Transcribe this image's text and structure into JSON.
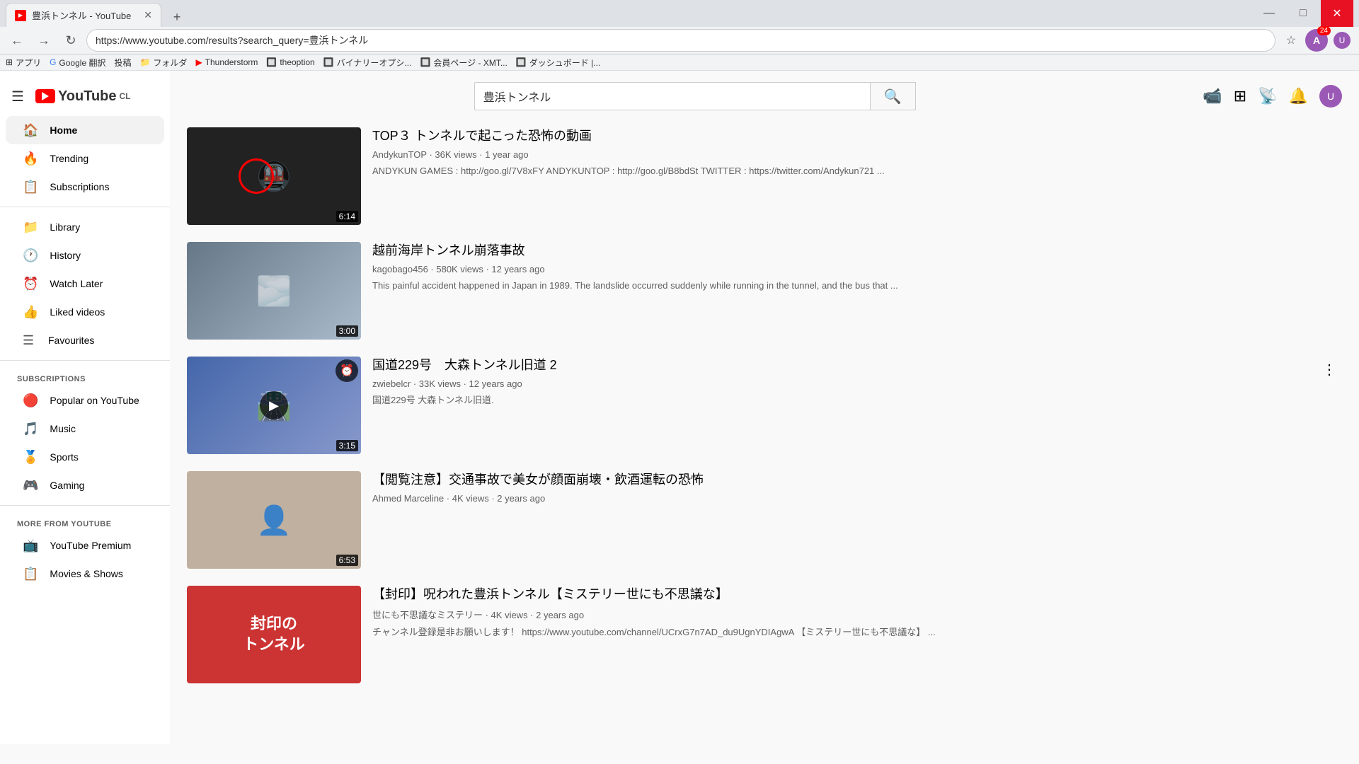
{
  "browser": {
    "tab_title": "豊浜トンネル - YouTube",
    "url": "https://www.youtube.com/results?search_query=豊浜トンネル",
    "new_tab_symbol": "+",
    "nav_back": "←",
    "nav_forward": "→",
    "nav_refresh": "↻",
    "bookmark_star": "☆",
    "window_minimize": "—",
    "window_maximize": "□",
    "window_close": "✕",
    "bookmarks": [
      {
        "label": "アプリ"
      },
      {
        "label": "Google 翻訳"
      },
      {
        "label": "投稿"
      },
      {
        "label": "フォルダ"
      },
      {
        "label": "Thunderstorm"
      },
      {
        "label": "theoption"
      },
      {
        "label": "バイナリーオプシ..."
      },
      {
        "label": "会員ページ - XMT..."
      },
      {
        "label": "ダッシュボード |..."
      }
    ]
  },
  "youtube": {
    "search_query": "豊浜トンネル",
    "logo_text": "YouTube",
    "logo_suffix": "CL"
  },
  "sidebar": {
    "hamburger": "☰",
    "nav_items": [
      {
        "label": "Home",
        "icon": "🏠",
        "active": true
      },
      {
        "label": "Trending",
        "icon": "🔥"
      },
      {
        "label": "Subscriptions",
        "icon": "📋"
      }
    ],
    "library_items": [
      {
        "label": "Library",
        "icon": "📁"
      },
      {
        "label": "History",
        "icon": "🕐"
      },
      {
        "label": "Watch Later",
        "icon": "⏰"
      },
      {
        "label": "Liked videos",
        "icon": "👍"
      },
      {
        "label": "Favourites",
        "icon": "☰"
      }
    ],
    "subscriptions_title": "SUBSCRIPTIONS",
    "subscription_items": [
      {
        "label": "Popular on YouTube",
        "icon": "🔴"
      },
      {
        "label": "Music",
        "icon": "🎵"
      },
      {
        "label": "Sports",
        "icon": "🏅"
      },
      {
        "label": "Gaming",
        "icon": "🎮"
      }
    ],
    "more_title": "MORE FROM YOUTUBE",
    "more_items": [
      {
        "label": "YouTube Premium",
        "icon": "📺"
      },
      {
        "label": "Movies & Shows",
        "icon": "📋"
      }
    ]
  },
  "videos": [
    {
      "id": 1,
      "title": "TOP３ トンネルで起こった恐怖の動画",
      "channel": "AndykunTOP",
      "views": "36K views",
      "age": "1 year ago",
      "duration": "6:14",
      "description": "ANDYKUN GAMES : http://goo.gl/7V8xFY ANDYKUNTOP : http://goo.gl/B8bdSt TWITTER : https://twitter.com/Andykun721 ...",
      "thumb_style": "dark",
      "has_red_circle": true,
      "has_watch_later": false,
      "has_play": false
    },
    {
      "id": 2,
      "title": "越前海岸トンネル崩落事故",
      "channel": "kagobago456",
      "views": "580K views",
      "age": "12 years ago",
      "duration": "3:00",
      "description": "This painful accident happened in Japan in 1989. The landslide occurred suddenly while running in the tunnel, and the bus that ...",
      "thumb_style": "gray",
      "has_red_circle": false,
      "has_watch_later": false,
      "has_play": false
    },
    {
      "id": 3,
      "title": "国道229号　大森トンネル旧道 2",
      "channel": "zwiebelcr",
      "views": "33K views",
      "age": "12 years ago",
      "duration": "3:15",
      "description": "国道229号 大森トンネル旧道.",
      "thumb_style": "blue",
      "has_red_circle": false,
      "has_watch_later": true,
      "has_play": true
    },
    {
      "id": 4,
      "title": "【閲覧注意】交通事故で美女が顔面崩壊・飲酒運転の恐怖",
      "channel": "Ahmed Marceline",
      "views": "4K views",
      "age": "2 years ago",
      "duration": "6:53",
      "description": "",
      "thumb_style": "face",
      "has_red_circle": false,
      "has_watch_later": false,
      "has_play": false
    },
    {
      "id": 5,
      "title": "【封印】呪われた豊浜トンネル【ミステリー世にも不思議な】",
      "channel": "世にも不思議なミステリー",
      "views": "4K views",
      "age": "2 years ago",
      "duration": "",
      "description": "チャンネル登録是非お願いします！ https://www.youtube.com/channel/UCrxG7n7AD_du9UgnYDIAgwA 【ミステリー世にも不思議な】 ...",
      "thumb_style": "red",
      "has_red_circle": false,
      "has_watch_later": false,
      "has_play": false
    }
  ],
  "menu_dots": "⋮",
  "notification_count": "24"
}
